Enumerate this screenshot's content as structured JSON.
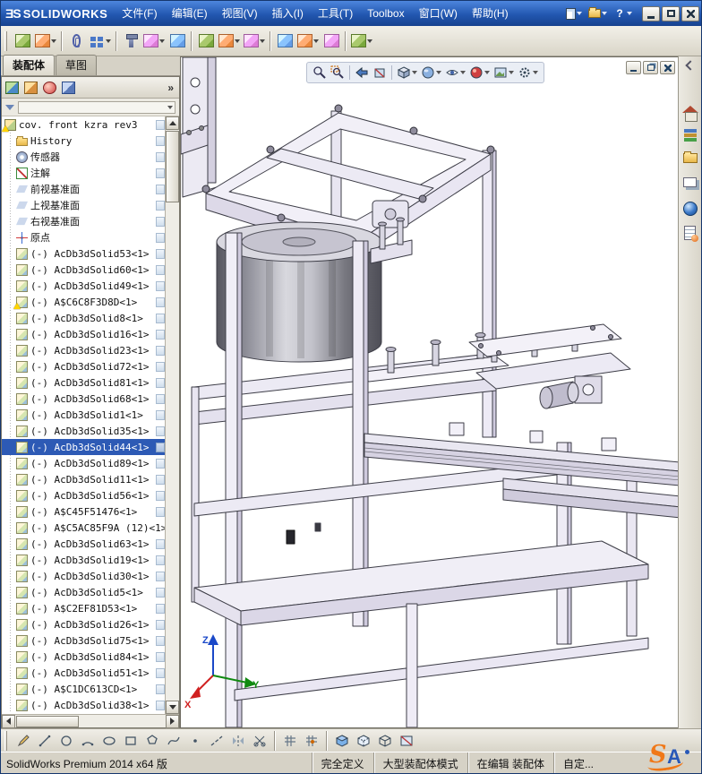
{
  "titlebar": {
    "brand_mark": "ƎS",
    "brand": "SOLIDWORKS",
    "menus": [
      "文件(F)",
      "编辑(E)",
      "视图(V)",
      "插入(I)",
      "工具(T)",
      "Toolbox",
      "窗口(W)",
      "帮助(H)"
    ],
    "quick_icons": [
      "new-document",
      "open-document",
      "help"
    ],
    "window_buttons": [
      "minimize",
      "maximize",
      "close"
    ]
  },
  "toolbar": {
    "icons": [
      "edit-component",
      "insert-components",
      "mate",
      "linear-component-pattern",
      "smart-fasteners",
      "move-component",
      "rotate-component",
      "show-hidden-components",
      "assembly-features",
      "reference-geometry",
      "new-motion-study",
      "exploded-view",
      "interference-detection",
      "instant3d"
    ]
  },
  "left_panel": {
    "tabs": [
      {
        "label": "装配体",
        "cls": "active"
      },
      {
        "label": "草图",
        "cls": ""
      }
    ],
    "header_icons": [
      "featuremanager-tree",
      "propertymanager",
      "configurationmanager",
      "dimxpert"
    ],
    "chevron": "»",
    "tree": {
      "items": [
        {
          "icon": "asm warn",
          "label": "cov. front kzra rev3",
          "cls": "root"
        },
        {
          "icon": "folder",
          "label": "History",
          "cls": ""
        },
        {
          "icon": "sensor",
          "label": "传感器",
          "cls": ""
        },
        {
          "icon": "annot",
          "label": "注解",
          "cls": ""
        },
        {
          "icon": "plane",
          "label": "前视基准面",
          "cls": ""
        },
        {
          "icon": "plane",
          "label": "上视基准面",
          "cls": ""
        },
        {
          "icon": "plane",
          "label": "右视基准面",
          "cls": ""
        },
        {
          "icon": "origin",
          "label": "原点",
          "cls": ""
        },
        {
          "icon": "part",
          "label": "(-) AcDb3dSolid53<1>",
          "cls": ""
        },
        {
          "icon": "part",
          "label": "(-) AcDb3dSolid60<1>",
          "cls": ""
        },
        {
          "icon": "part",
          "label": "(-) AcDb3dSolid49<1>",
          "cls": ""
        },
        {
          "icon": "part warn",
          "label": "(-) A$C6C8F3D8D<1>",
          "cls": ""
        },
        {
          "icon": "part",
          "label": "(-) AcDb3dSolid8<1>",
          "cls": ""
        },
        {
          "icon": "part",
          "label": "(-) AcDb3dSolid16<1>",
          "cls": ""
        },
        {
          "icon": "part",
          "label": "(-) AcDb3dSolid23<1>",
          "cls": ""
        },
        {
          "icon": "part",
          "label": "(-) AcDb3dSolid72<1>",
          "cls": ""
        },
        {
          "icon": "part",
          "label": "(-) AcDb3dSolid81<1>",
          "cls": ""
        },
        {
          "icon": "part",
          "label": "(-) AcDb3dSolid68<1>",
          "cls": ""
        },
        {
          "icon": "part",
          "label": "(-) AcDb3dSolid1<1>",
          "cls": ""
        },
        {
          "icon": "part",
          "label": "(-) AcDb3dSolid35<1>",
          "cls": ""
        },
        {
          "icon": "part",
          "label": "(-) AcDb3dSolid44<1>",
          "cls": "sel"
        },
        {
          "icon": "part",
          "label": "(-) AcDb3dSolid89<1>",
          "cls": ""
        },
        {
          "icon": "part",
          "label": "(-) AcDb3dSolid11<1>",
          "cls": ""
        },
        {
          "icon": "part",
          "label": "(-) AcDb3dSolid56<1>",
          "cls": ""
        },
        {
          "icon": "part",
          "label": "(-) A$C45F51476<1>",
          "cls": ""
        },
        {
          "icon": "part",
          "label": "(-) A$C5AC85F9A (12)<1>",
          "cls": ""
        },
        {
          "icon": "part",
          "label": "(-) AcDb3dSolid63<1>",
          "cls": ""
        },
        {
          "icon": "part",
          "label": "(-) AcDb3dSolid19<1>",
          "cls": ""
        },
        {
          "icon": "part",
          "label": "(-) AcDb3dSolid30<1>",
          "cls": ""
        },
        {
          "icon": "part",
          "label": "(-) AcDb3dSolid5<1>",
          "cls": ""
        },
        {
          "icon": "part",
          "label": "(-) A$C2EF81D53<1>",
          "cls": ""
        },
        {
          "icon": "part",
          "label": "(-) AcDb3dSolid26<1>",
          "cls": ""
        },
        {
          "icon": "part",
          "label": "(-) AcDb3dSolid75<1>",
          "cls": ""
        },
        {
          "icon": "part",
          "label": "(-) AcDb3dSolid84<1>",
          "cls": ""
        },
        {
          "icon": "part",
          "label": "(-) AcDb3dSolid51<1>",
          "cls": ""
        },
        {
          "icon": "part",
          "label": "(-) A$C1DC613CD<1>",
          "cls": ""
        },
        {
          "icon": "part",
          "label": "(-) AcDb3dSolid38<1>",
          "cls": ""
        }
      ]
    }
  },
  "viewport": {
    "headsup_icons": [
      "zoom-to-fit",
      "zoom-to-area",
      "previous-view",
      "section-view",
      "view-orientation",
      "display-style",
      "hide-show-items",
      "edit-appearance",
      "apply-scene",
      "view-settings"
    ],
    "doc_window_buttons": [
      "minimize-document",
      "restore-document",
      "close-document"
    ],
    "triad": {
      "x": "X",
      "y": "Y",
      "z": "Z"
    }
  },
  "taskpane": {
    "icons": [
      "solidworks-resources-home",
      "design-library",
      "file-explorer",
      "view-palette",
      "appearances-scenes",
      "custom-properties"
    ]
  },
  "bottombar": {
    "icons": [
      "sketch",
      "line",
      "circle",
      "arc",
      "ellipse",
      "corner-rectangle",
      "polygon",
      "spline",
      "point",
      "centerline",
      "mirror-entities",
      "trim-entities",
      "grid",
      "snap",
      "shaded-with-edges",
      "hidden-lines-visible",
      "wireframe",
      "section-view-tool"
    ]
  },
  "statusbar": {
    "left": "SolidWorks Premium 2014 x64 版",
    "fields": [
      "完全定义",
      "大型装配体模式",
      "在编辑 装配体",
      "自定..."
    ],
    "watermark": {
      "s": "S",
      "a": "A"
    }
  }
}
